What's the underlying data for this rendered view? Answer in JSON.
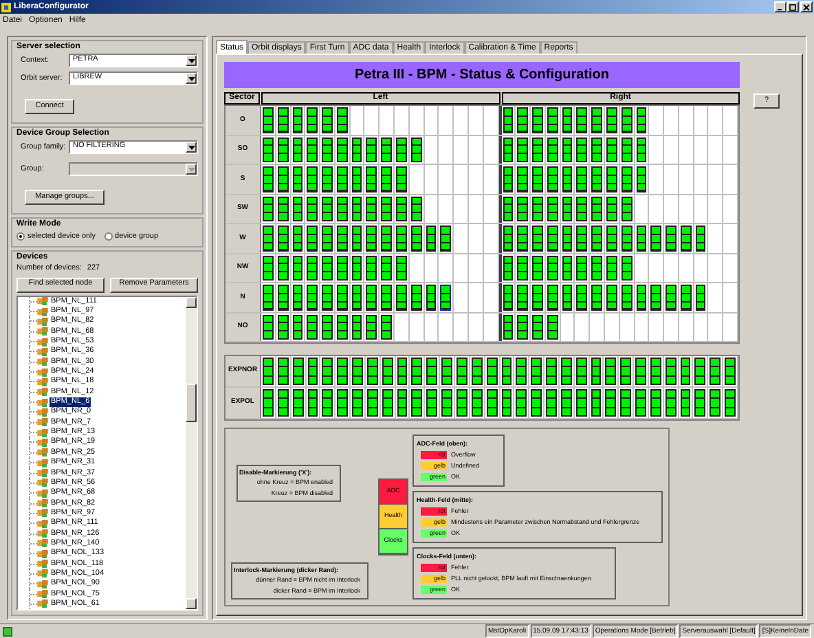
{
  "window": {
    "title": "LiberaConfigurator"
  },
  "menu": [
    "Datei",
    "Optionen",
    "Hilfe"
  ],
  "server_selection": {
    "title": "Server selection",
    "context_label": "Context:",
    "context_value": "PETRA",
    "orbit_server_label": "Orbit server:",
    "orbit_server_value": "LIBREW",
    "connect_button": "Connect"
  },
  "device_group": {
    "title": "Device Group Selection",
    "family_label": "Group family:",
    "family_value": "NO FILTERING",
    "group_label": "Group:",
    "group_disabled": true,
    "manage_button": "Manage groups..."
  },
  "write_mode": {
    "title": "Write Mode",
    "options": [
      {
        "label": "selected device only",
        "selected": true
      },
      {
        "label": "device group",
        "selected": false
      }
    ]
  },
  "devices": {
    "title": "Devices",
    "count_label": "Number of devices:",
    "count": "227",
    "find_button": "Find selected node",
    "remove_button": "Remove Parameters",
    "items": [
      {
        "label": "BPM_NL_111",
        "selected": false
      },
      {
        "label": "BPM_NL_97",
        "selected": false
      },
      {
        "label": "BPM_NL_82",
        "selected": false
      },
      {
        "label": "BPM_NL_68",
        "selected": false
      },
      {
        "label": "BPM_NL_53",
        "selected": false
      },
      {
        "label": "BPM_NL_36",
        "selected": false
      },
      {
        "label": "BPM_NL_30",
        "selected": false
      },
      {
        "label": "BPM_NL_24",
        "selected": false
      },
      {
        "label": "BPM_NL_18",
        "selected": false
      },
      {
        "label": "BPM_NL_12",
        "selected": false
      },
      {
        "label": "BPM_NL_6",
        "selected": true
      },
      {
        "label": "BPM_NR_0",
        "selected": false
      },
      {
        "label": "BPM_NR_7",
        "selected": false
      },
      {
        "label": "BPM_NR_13",
        "selected": false
      },
      {
        "label": "BPM_NR_19",
        "selected": false
      },
      {
        "label": "BPM_NR_25",
        "selected": false
      },
      {
        "label": "BPM_NR_31",
        "selected": false
      },
      {
        "label": "BPM_NR_37",
        "selected": false
      },
      {
        "label": "BPM_NR_56",
        "selected": false
      },
      {
        "label": "BPM_NR_68",
        "selected": false
      },
      {
        "label": "BPM_NR_82",
        "selected": false
      },
      {
        "label": "BPM_NR_97",
        "selected": false
      },
      {
        "label": "BPM_NR_111",
        "selected": false
      },
      {
        "label": "BPM_NR_126",
        "selected": false
      },
      {
        "label": "BPM_NR_140",
        "selected": false
      },
      {
        "label": "BPM_NOL_133",
        "selected": false
      },
      {
        "label": "BPM_NOL_118",
        "selected": false
      },
      {
        "label": "BPM_NOL_104",
        "selected": false
      },
      {
        "label": "BPM_NOL_90",
        "selected": false
      },
      {
        "label": "BPM_NOL_75",
        "selected": false
      },
      {
        "label": "BPM_NOL_61",
        "selected": false
      }
    ]
  },
  "tabs": [
    {
      "label": "Status",
      "selected": true
    },
    {
      "label": "Orbit displays",
      "selected": false
    },
    {
      "label": "First Turn",
      "selected": false
    },
    {
      "label": "ADC data",
      "selected": false
    },
    {
      "label": "Health",
      "selected": false
    },
    {
      "label": "Interlock",
      "selected": false
    },
    {
      "label": "Calibration & Time",
      "selected": false
    },
    {
      "label": "Reports",
      "selected": false
    }
  ],
  "banner": "Petra III - BPM - Status & Configuration",
  "help_button": "?",
  "grid": {
    "columns": [
      "Sector",
      "Left",
      "Right"
    ],
    "sectors": [
      {
        "name": "O",
        "left": [
          {
            "selected": false
          },
          {
            "selected": false
          },
          {
            "selected": false
          },
          {
            "selected": false
          },
          {
            "selected": false
          },
          {
            "selected": false
          }
        ],
        "right": [
          {
            "selected": false
          },
          {
            "selected": false
          },
          {
            "selected": false
          },
          {
            "selected": false
          },
          {
            "selected": false
          },
          {
            "selected": false
          },
          {
            "selected": false
          },
          {
            "selected": false
          },
          {
            "selected": false
          },
          {
            "selected": false
          }
        ]
      },
      {
        "name": "SO",
        "left": [
          {
            "selected": false
          },
          {
            "selected": false
          },
          {
            "selected": false
          },
          {
            "selected": false
          },
          {
            "selected": false
          },
          {
            "selected": false
          },
          {
            "selected": false
          },
          {
            "selected": false
          },
          {
            "selected": false
          },
          {
            "selected": false
          },
          {
            "selected": false
          }
        ],
        "right": [
          {
            "selected": false
          },
          {
            "selected": false
          },
          {
            "selected": false
          },
          {
            "selected": false
          },
          {
            "selected": false
          },
          {
            "selected": false
          },
          {
            "selected": false
          },
          {
            "selected": false
          },
          {
            "selected": false
          },
          {
            "selected": false
          }
        ]
      },
      {
        "name": "S",
        "left": [
          {
            "selected": false
          },
          {
            "selected": false
          },
          {
            "selected": false
          },
          {
            "selected": false
          },
          {
            "selected": false
          },
          {
            "selected": false
          },
          {
            "selected": false
          },
          {
            "selected": false
          },
          {
            "selected": false
          },
          {
            "selected": false
          }
        ],
        "right": [
          {
            "selected": false
          },
          {
            "selected": false
          },
          {
            "selected": false
          },
          {
            "selected": false
          },
          {
            "selected": false
          },
          {
            "selected": false
          },
          {
            "selected": false
          },
          {
            "selected": false
          },
          {
            "selected": false
          },
          {
            "selected": false
          }
        ]
      },
      {
        "name": "SW",
        "left": [
          {
            "selected": false
          },
          {
            "selected": false
          },
          {
            "selected": false
          },
          {
            "selected": false
          },
          {
            "selected": false
          },
          {
            "selected": false
          },
          {
            "selected": false
          },
          {
            "selected": false
          },
          {
            "selected": false
          },
          {
            "selected": false
          },
          {
            "selected": false
          }
        ],
        "right": [
          {
            "selected": false
          },
          {
            "selected": false
          },
          {
            "selected": false
          },
          {
            "selected": false
          },
          {
            "selected": false
          },
          {
            "selected": false
          },
          {
            "selected": false
          },
          {
            "selected": false
          },
          {
            "selected": false
          }
        ]
      },
      {
        "name": "W",
        "left": [
          {
            "selected": false
          },
          {
            "selected": false
          },
          {
            "selected": false
          },
          {
            "selected": false
          },
          {
            "selected": false
          },
          {
            "selected": false
          },
          {
            "selected": false
          },
          {
            "selected": false
          },
          {
            "selected": false
          },
          {
            "selected": false
          },
          {
            "selected": false
          },
          {
            "selected": false
          },
          {
            "selected": false
          }
        ],
        "right": [
          {
            "selected": false
          },
          {
            "selected": false
          },
          {
            "selected": false
          },
          {
            "selected": false
          },
          {
            "selected": false
          },
          {
            "selected": false
          },
          {
            "selected": false
          },
          {
            "selected": false
          },
          {
            "selected": false
          },
          {
            "selected": false
          },
          {
            "selected": false
          },
          {
            "selected": false
          },
          {
            "selected": false
          },
          {
            "selected": false
          }
        ]
      },
      {
        "name": "NW",
        "left": [
          {
            "selected": false
          },
          {
            "selected": false
          },
          {
            "selected": false
          },
          {
            "selected": false
          },
          {
            "selected": false
          },
          {
            "selected": false
          },
          {
            "selected": false
          },
          {
            "selected": false
          },
          {
            "selected": false
          },
          {
            "selected": false
          }
        ],
        "right": [
          {
            "selected": false
          },
          {
            "selected": false
          },
          {
            "selected": false
          },
          {
            "selected": false
          },
          {
            "selected": false
          },
          {
            "selected": false
          },
          {
            "selected": false
          },
          {
            "selected": false
          },
          {
            "selected": false
          }
        ]
      },
      {
        "name": "N",
        "left": [
          {
            "selected": false
          },
          {
            "selected": false
          },
          {
            "selected": false
          },
          {
            "selected": false
          },
          {
            "selected": false
          },
          {
            "selected": false
          },
          {
            "selected": false
          },
          {
            "selected": false
          },
          {
            "selected": false
          },
          {
            "selected": false
          },
          {
            "selected": false
          },
          {
            "selected": false
          },
          {
            "selected": true
          }
        ],
        "right": [
          {
            "selected": false
          },
          {
            "selected": false
          },
          {
            "selected": false
          },
          {
            "selected": false
          },
          {
            "selected": false
          },
          {
            "selected": false
          },
          {
            "selected": false
          },
          {
            "selected": false
          },
          {
            "selected": false
          },
          {
            "selected": false
          },
          {
            "selected": false
          },
          {
            "selected": false
          },
          {
            "selected": false
          },
          {
            "selected": false
          }
        ]
      },
      {
        "name": "NO",
        "left": [
          {
            "selected": false
          },
          {
            "selected": false
          },
          {
            "selected": false
          },
          {
            "selected": false
          },
          {
            "selected": false
          },
          {
            "selected": false
          },
          {
            "selected": false
          },
          {
            "selected": false
          },
          {
            "selected": false
          }
        ],
        "right": [
          {
            "selected": false
          },
          {
            "selected": false
          },
          {
            "selected": false
          },
          {
            "selected": false
          }
        ]
      }
    ],
    "extra": [
      {
        "name": "EXPNOR",
        "cells": [
          {
            "selected": false
          },
          {
            "selected": false
          },
          {
            "selected": false
          },
          {
            "selected": false
          },
          {
            "selected": false
          },
          {
            "selected": false
          },
          {
            "selected": false
          },
          {
            "selected": false
          },
          {
            "selected": false
          },
          {
            "selected": false
          },
          {
            "selected": false
          },
          {
            "selected": false
          },
          {
            "selected": false
          },
          {
            "selected": false
          },
          {
            "selected": false
          },
          {
            "selected": false
          },
          {
            "selected": false
          },
          {
            "selected": false
          },
          {
            "selected": false
          },
          {
            "selected": false
          },
          {
            "selected": false
          },
          {
            "selected": false
          },
          {
            "selected": false
          },
          {
            "selected": false
          },
          {
            "selected": false
          },
          {
            "selected": false
          },
          {
            "selected": false
          },
          {
            "selected": false
          },
          {
            "selected": false
          },
          {
            "selected": false
          },
          {
            "selected": false
          },
          {
            "selected": false
          }
        ]
      },
      {
        "name": "EXPOL",
        "cells": [
          {
            "selected": false
          },
          {
            "selected": false
          },
          {
            "selected": false
          },
          {
            "selected": false
          },
          {
            "selected": false
          },
          {
            "selected": false
          },
          {
            "selected": false
          },
          {
            "selected": false
          },
          {
            "selected": false
          },
          {
            "selected": false
          },
          {
            "selected": false
          },
          {
            "selected": false
          },
          {
            "selected": false
          },
          {
            "selected": false
          },
          {
            "selected": false
          },
          {
            "selected": false
          },
          {
            "selected": false
          },
          {
            "selected": false
          },
          {
            "selected": false
          },
          {
            "selected": false
          },
          {
            "selected": false
          },
          {
            "selected": false
          },
          {
            "selected": false
          },
          {
            "selected": false
          },
          {
            "selected": false
          },
          {
            "selected": false
          },
          {
            "selected": false
          },
          {
            "selected": false
          },
          {
            "selected": false
          },
          {
            "selected": false
          },
          {
            "selected": false
          },
          {
            "selected": false
          }
        ]
      }
    ]
  },
  "legend": {
    "disable": {
      "title": "Disable-Markierung ('X'):",
      "lines": [
        "ohne Kreuz = BPM enabled",
        "Kreuz = BPM disabled"
      ]
    },
    "interlock": {
      "title": "Interlock-Markierung (dicker Rand):",
      "lines": [
        "dünner Rand = BPM nicht im Interlock",
        "dicker Rand = BPM im Interlock"
      ]
    },
    "stack": [
      {
        "label": "ADC",
        "color": "#ff1a40"
      },
      {
        "label": "Health",
        "color": "#ffcc33"
      },
      {
        "label": "Clocks",
        "color": "#66ff66"
      }
    ],
    "sections": [
      {
        "title": "ADC-Feld (oben):",
        "entries": [
          {
            "swatch": "rot",
            "color": "#ff1a40",
            "text": "Overflow"
          },
          {
            "swatch": "gelb",
            "color": "#ffcc33",
            "text": "Undefined"
          },
          {
            "swatch": "green",
            "color": "#66ff66",
            "text": "OK"
          }
        ]
      },
      {
        "title": "Health-Feld (mitte):",
        "entries": [
          {
            "swatch": "rot",
            "color": "#ff1a40",
            "text": "Fehler"
          },
          {
            "swatch": "gelb",
            "color": "#ffcc33",
            "text": "Mindestens ein Parameter zwischen Normabstand und Fehlergrenze"
          },
          {
            "swatch": "green",
            "color": "#66ff66",
            "text": "OK"
          }
        ]
      },
      {
        "title": "Clocks-Feld (unten):",
        "entries": [
          {
            "swatch": "rot",
            "color": "#ff1a40",
            "text": "Fehler"
          },
          {
            "swatch": "gelb",
            "color": "#ffcc33",
            "text": "PLL nicht gelockt, BPM lauft mit Einschraenkungen"
          },
          {
            "swatch": "green",
            "color": "#66ff66",
            "text": "OK"
          }
        ]
      }
    ]
  },
  "status_bar": [
    "MstOpKaroli",
    "15.09.09 17:43:13",
    "Operations Mode [Betrieb]",
    "Serverauswahl [Default]",
    "[S]KeineInDate"
  ]
}
